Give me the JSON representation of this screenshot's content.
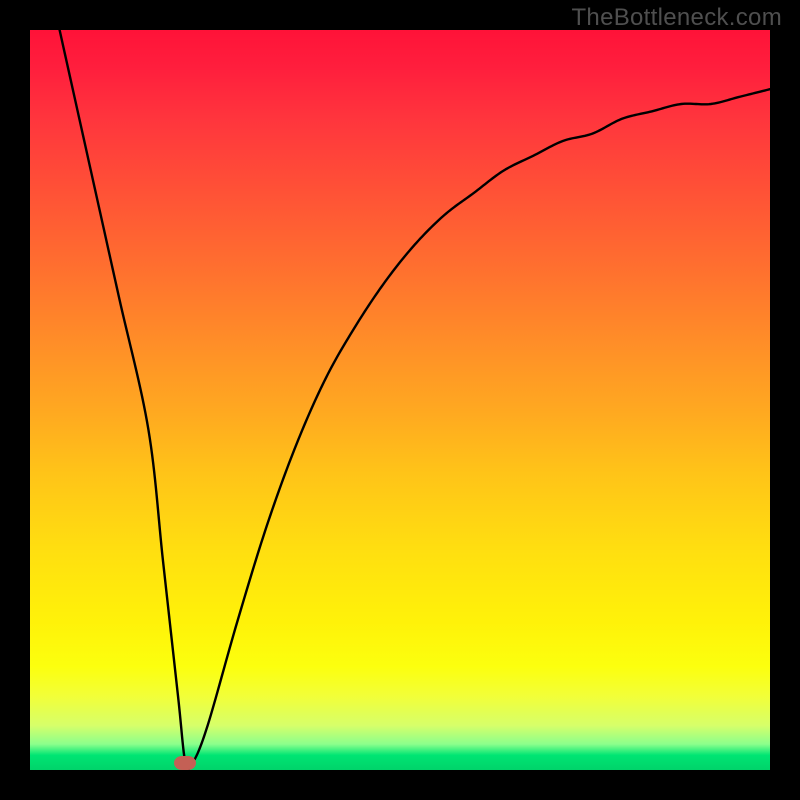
{
  "watermark": "TheBottleneck.com",
  "chart_data": {
    "type": "line",
    "title": "",
    "xlabel": "",
    "ylabel": "",
    "xlim": [
      0,
      100
    ],
    "ylim": [
      0,
      100
    ],
    "background_gradient": {
      "top_color": "#ff1238",
      "bottom_color": "#00d36a",
      "meaning": "red = high bottleneck, green = optimal"
    },
    "series": [
      {
        "name": "bottleneck-curve",
        "x": [
          4,
          8,
          12,
          16,
          18,
          20,
          21,
          22,
          24,
          28,
          32,
          36,
          40,
          44,
          48,
          52,
          56,
          60,
          64,
          68,
          72,
          76,
          80,
          84,
          88,
          92,
          96,
          100
        ],
        "values": [
          100,
          82,
          64,
          46,
          28,
          10,
          1,
          1,
          6,
          20,
          33,
          44,
          53,
          60,
          66,
          71,
          75,
          78,
          81,
          83,
          85,
          86,
          88,
          89,
          90,
          90,
          91,
          92
        ]
      }
    ],
    "marker": {
      "name": "optimal-point",
      "x": 21,
      "y": 1,
      "color": "#c46055"
    }
  }
}
